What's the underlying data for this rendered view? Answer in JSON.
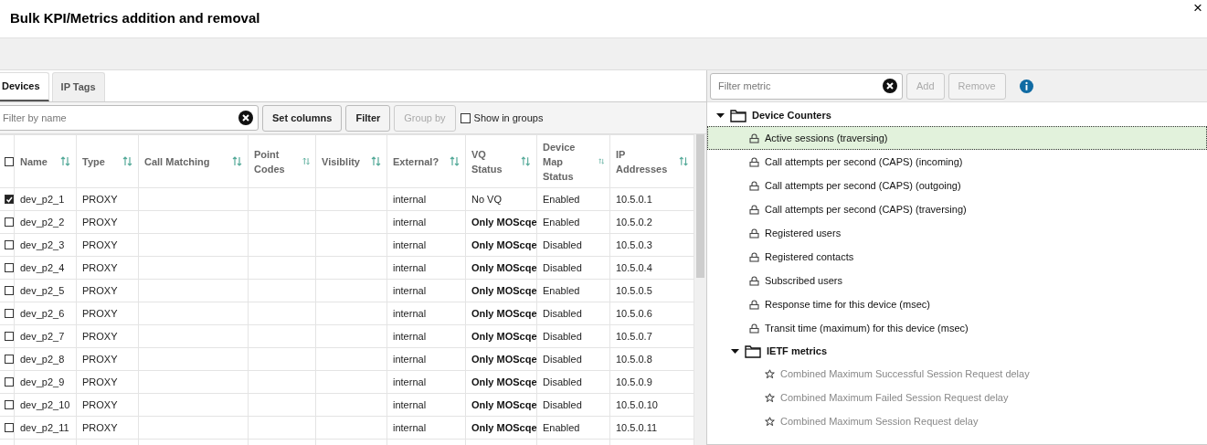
{
  "dialog": {
    "title": "Bulk KPI/Metrics addition and removal",
    "close": "×"
  },
  "tabs": [
    {
      "label": "Devices",
      "selected": true
    },
    {
      "label": "IP Tags",
      "selected": false
    }
  ],
  "device_toolbar": {
    "filter": {
      "placeholder": "Filter by name"
    },
    "buttons": [
      {
        "label": "Set columns",
        "disabled": false
      },
      {
        "label": "Filter",
        "disabled": false
      },
      {
        "label": "Group by",
        "disabled": true
      }
    ],
    "show_in_groups": {
      "label": "Show in groups",
      "checked": false
    }
  },
  "table": {
    "all_checked": false,
    "columns": [
      "Name",
      "Type",
      "Call Matching",
      "Point Codes",
      "Visiblity",
      "External?",
      "VQ Status",
      "Device Map Status",
      "IP Addresses"
    ],
    "rows": [
      {
        "checked": true,
        "cells": [
          "dev_p2_1",
          "PROXY",
          "",
          "",
          "",
          "internal",
          "No VQ",
          "Enabled",
          "10.5.0.1"
        ],
        "vq_bold": false
      },
      {
        "checked": false,
        "cells": [
          "dev_p2_2",
          "PROXY",
          "",
          "",
          "",
          "internal",
          "Only MOScqe",
          "Enabled",
          "10.5.0.2"
        ],
        "vq_bold": true
      },
      {
        "checked": false,
        "cells": [
          "dev_p2_3",
          "PROXY",
          "",
          "",
          "",
          "internal",
          "Only MOScqe",
          "Disabled",
          "10.5.0.3"
        ],
        "vq_bold": true
      },
      {
        "checked": false,
        "cells": [
          "dev_p2_4",
          "PROXY",
          "",
          "",
          "",
          "internal",
          "Only MOScqe",
          "Disabled",
          "10.5.0.4"
        ],
        "vq_bold": true
      },
      {
        "checked": false,
        "cells": [
          "dev_p2_5",
          "PROXY",
          "",
          "",
          "",
          "internal",
          "Only MOScqe",
          "Enabled",
          "10.5.0.5"
        ],
        "vq_bold": true
      },
      {
        "checked": false,
        "cells": [
          "dev_p2_6",
          "PROXY",
          "",
          "",
          "",
          "internal",
          "Only MOScqe",
          "Disabled",
          "10.5.0.6"
        ],
        "vq_bold": true
      },
      {
        "checked": false,
        "cells": [
          "dev_p2_7",
          "PROXY",
          "",
          "",
          "",
          "internal",
          "Only MOScqe",
          "Disabled",
          "10.5.0.7"
        ],
        "vq_bold": true
      },
      {
        "checked": false,
        "cells": [
          "dev_p2_8",
          "PROXY",
          "",
          "",
          "",
          "internal",
          "Only MOScqe",
          "Disabled",
          "10.5.0.8"
        ],
        "vq_bold": true
      },
      {
        "checked": false,
        "cells": [
          "dev_p2_9",
          "PROXY",
          "",
          "",
          "",
          "internal",
          "Only MOScqe",
          "Disabled",
          "10.5.0.9"
        ],
        "vq_bold": true
      },
      {
        "checked": false,
        "cells": [
          "dev_p2_10",
          "PROXY",
          "",
          "",
          "",
          "internal",
          "Only MOScqe",
          "Disabled",
          "10.5.0.10"
        ],
        "vq_bold": true
      },
      {
        "checked": false,
        "cells": [
          "dev_p2_11",
          "PROXY",
          "",
          "",
          "",
          "internal",
          "Only MOScqe",
          "Enabled",
          "10.5.0.11"
        ],
        "vq_bold": true
      }
    ]
  },
  "metric_toolbar": {
    "filter": {
      "placeholder": "Filter metric"
    },
    "buttons": [
      {
        "label": "Add",
        "disabled": true
      },
      {
        "label": "Remove",
        "disabled": true
      }
    ]
  },
  "tree": [
    {
      "kind": "folder",
      "label": "Device Counters",
      "expanded": true,
      "children": [
        {
          "kind": "lock",
          "label": "Active sessions (traversing)",
          "selected": true,
          "disabled": false
        },
        {
          "kind": "lock",
          "label": "Call attempts per second (CAPS) (incoming)",
          "selected": false,
          "disabled": false
        },
        {
          "kind": "lock",
          "label": "Call attempts per second (CAPS) (outgoing)",
          "selected": false,
          "disabled": false
        },
        {
          "kind": "lock",
          "label": "Call attempts per second (CAPS) (traversing)",
          "selected": false,
          "disabled": false
        },
        {
          "kind": "lock",
          "label": "Registered users",
          "selected": false,
          "disabled": false
        },
        {
          "kind": "lock",
          "label": "Registered contacts",
          "selected": false,
          "disabled": false
        },
        {
          "kind": "lock",
          "label": "Subscribed users",
          "selected": false,
          "disabled": false
        },
        {
          "kind": "lock",
          "label": "Response time for this device (msec)",
          "selected": false,
          "disabled": false
        },
        {
          "kind": "lock",
          "label": "Transit time (maximum) for this device (msec)",
          "selected": false,
          "disabled": false
        },
        {
          "kind": "folder",
          "label": "IETF metrics",
          "expanded": true,
          "children": [
            {
              "kind": "star",
              "label": "Combined Maximum Successful Session Request delay",
              "selected": false,
              "disabled": true
            },
            {
              "kind": "star",
              "label": "Combined Maximum Failed Session Request delay",
              "selected": false,
              "disabled": true
            },
            {
              "kind": "star",
              "label": "Combined Maximum Session Request delay",
              "selected": false,
              "disabled": true
            }
          ]
        }
      ]
    }
  ]
}
